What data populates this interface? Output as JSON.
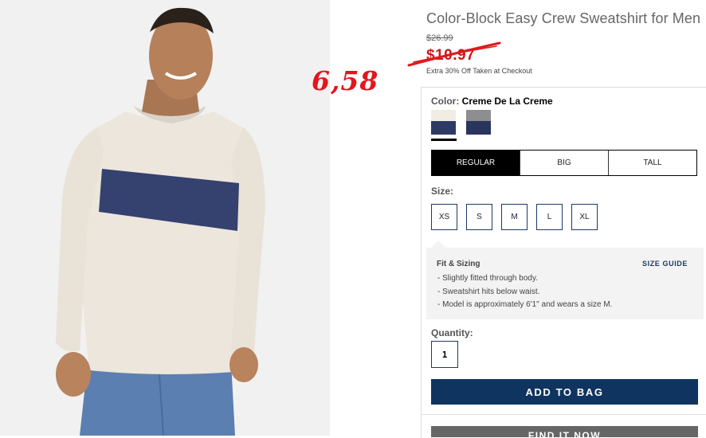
{
  "product": {
    "title": "Color-Block Easy Crew Sweatshirt for Men",
    "original_price": "$26.99",
    "sale_price": "$10.97",
    "promo_text": "Extra 30% Off Taken at Checkout",
    "handwritten_price": "6,58"
  },
  "color": {
    "label": "Color:",
    "selected": "Creme De La Creme",
    "swatches": [
      {
        "name": "creme navy",
        "top_color": "#f1ede4",
        "bottom_color": "#2c3a64"
      },
      {
        "name": "grey navy",
        "top_color": "#8e8e90",
        "bottom_color": "#29355c"
      }
    ]
  },
  "fit_tabs": [
    "REGULAR",
    "BIG",
    "TALL"
  ],
  "size": {
    "label": "Size:",
    "options": [
      "XS",
      "S",
      "M",
      "L",
      "XL"
    ]
  },
  "fit_sizing": {
    "title": "Fit & Sizing",
    "guide_link": "SIZE GUIDE",
    "bullets": [
      "-  Slightly fitted through body.",
      "-  Sweatshirt hits below waist.",
      "-  Model is approximately 6'1\" and wears a size M."
    ]
  },
  "quantity": {
    "label": "Quantity:",
    "value": "1"
  },
  "buttons": {
    "add_to_bag": "ADD TO BAG",
    "find_in_store": "FIND IT NOW"
  },
  "colors": {
    "accent_navy": "#0f3460",
    "sale_red": "#cc1818",
    "annotation_red": "#e0181e"
  }
}
